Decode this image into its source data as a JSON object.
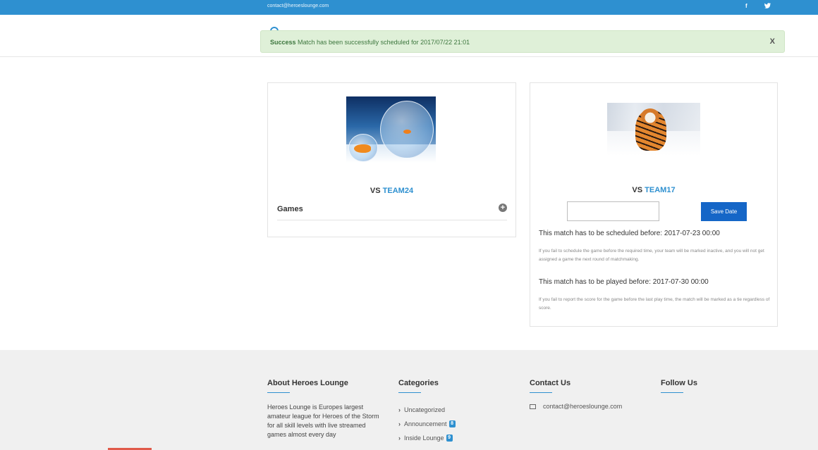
{
  "topbar": {
    "email": "contact@heroeslounge.com",
    "facebook_icon": "f",
    "twitter_icon": "✓"
  },
  "alert": {
    "strong": "Success",
    "message": " Match has been successfully scheduled for 2017/07/22 21:01",
    "close": "X"
  },
  "left_card": {
    "vs": "VS",
    "team": "TEAM24",
    "games_label": "Games",
    "plus": "+"
  },
  "right_card": {
    "vs": "VS",
    "team": "TEAM17",
    "date_value": "",
    "save_label": "Save Date",
    "scheduled_before": "This match has to be scheduled before: 2017-07-23 00:00",
    "scheduled_note": "If you fail to schedule the game before the required time, your team will be marked inactive, and you will not get assigned a game the next round of matchmaking.",
    "played_before": "This match has to be played before: 2017-07-30 00:00",
    "played_note": "If you fail to report the score for the game before the last play time, the match will be marked as a tie regardless of score."
  },
  "footer": {
    "about": {
      "title": "About Heroes Lounge",
      "text": "Heroes Lounge is Europes largest amateur league for Heroes of the Storm for all skill levels with live streamed games almost every day"
    },
    "categories": {
      "title": "Categories",
      "items": [
        {
          "label": "Uncategorized",
          "count": ""
        },
        {
          "label": "Announcement",
          "count": "8"
        },
        {
          "label": "Inside Lounge",
          "count": "9"
        }
      ]
    },
    "contact": {
      "title": "Contact Us",
      "email": "contact@heroeslounge.com"
    },
    "follow": {
      "title": "Follow Us"
    }
  }
}
